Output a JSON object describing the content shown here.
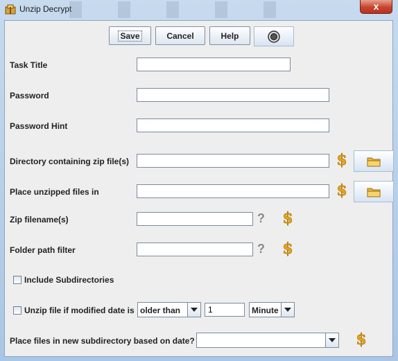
{
  "window": {
    "title": "Unzip Decrypt",
    "close_label": "x"
  },
  "toolbar": {
    "save_label": "Save",
    "cancel_label": "Cancel",
    "help_label": "Help"
  },
  "fields": {
    "task_title": {
      "label": "Task Title",
      "value": ""
    },
    "password": {
      "label": "Password",
      "value": ""
    },
    "password_hint": {
      "label": "Password Hint",
      "value": ""
    },
    "zip_directory": {
      "label": "Directory containing zip file(s)",
      "value": ""
    },
    "unzip_destination": {
      "label": "Place unzipped files in",
      "value": ""
    },
    "zip_filenames": {
      "label": "Zip filename(s)",
      "value": ""
    },
    "folder_filter": {
      "label": "Folder path filter",
      "value": ""
    }
  },
  "include_subdirectories": {
    "label": "Include Subdirectories",
    "checked": false
  },
  "modified_date": {
    "label": "Unzip file if modified date is",
    "checked": false,
    "comparison": "older than",
    "amount": "1",
    "unit": "Minute"
  },
  "date_subdirectory": {
    "label": "Place files in new subdirectory based on date?",
    "value": ""
  },
  "icons": {
    "variable": "dollar-icon",
    "help": "question-icon",
    "browse": "folder-icon",
    "record": "record-icon",
    "app": "app-icon"
  },
  "colors": {
    "accent": "#f0b020",
    "window_frame": "#bcd3ea",
    "panel": "#eeeeee",
    "close": "#c7442e"
  }
}
